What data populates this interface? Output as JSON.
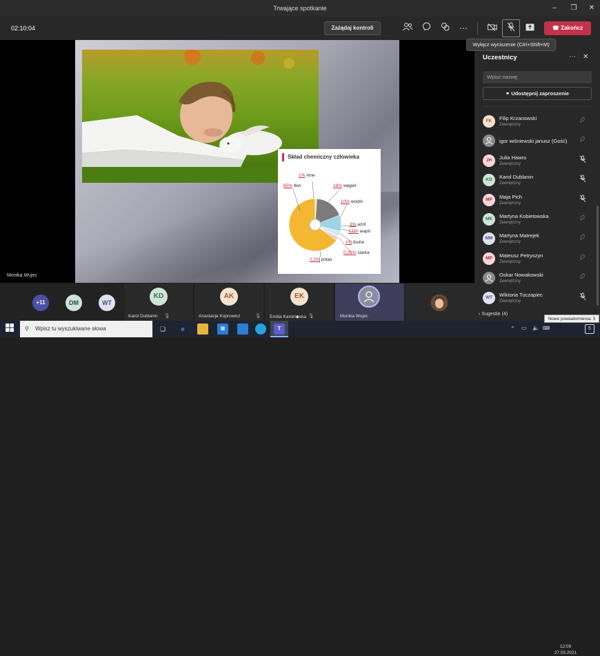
{
  "window": {
    "title": "Trwające spotkanie"
  },
  "toolbar": {
    "timer": "02:10:04",
    "request_control": "Zażądaj kontroli",
    "end_call": "Zakończ",
    "tooltip": "Wyłącz wyciszenie (Ctrl+Shift+M)"
  },
  "slide": {
    "chart_title": "Skład chemiczny człowieka",
    "chart_data": {
      "type": "pie",
      "title": "Skład chemiczny człowieka",
      "slices": [
        {
          "label": "tlen",
          "value": 65
        },
        {
          "label": "węgiel",
          "value": 18
        },
        {
          "label": "wodór",
          "value": 10
        },
        {
          "label": "azot",
          "value": 3
        },
        {
          "label": "wapń",
          "value": 1.5
        },
        {
          "label": "fosfor",
          "value": 1
        },
        {
          "label": "siarka",
          "value": 0.25
        },
        {
          "label": "potas",
          "value": 0.2
        },
        {
          "label": "inne",
          "value": 1
        }
      ]
    },
    "labels": {
      "inne_v": "1%",
      "inne": "inne",
      "tlen_v": "65%",
      "tlen": "tlen",
      "wegiel_v": "18%",
      "wegiel": "węgiel",
      "wodor_v": "10%",
      "wodor": "wodór",
      "azot_v": "3%",
      "azot": "azot",
      "wapn_v": "1,5%",
      "wapn": "wapń",
      "fosfor_v": "1%",
      "fosfor": "fosfor",
      "siarka_v": "0,25%",
      "siarka": "siarka",
      "potas_v": "0,2%",
      "potas": "potas"
    }
  },
  "speaker_name": "Monika Wujec",
  "gallery": {
    "overflow": "+11",
    "small": [
      "DM",
      "WT"
    ],
    "tiles": [
      {
        "initials": "KD",
        "name": "Karol Dublanin"
      },
      {
        "initials": "AK",
        "name": "Anastazja Koprowicz"
      },
      {
        "initials": "EK",
        "name": "Emilia Kamiń◆ska"
      },
      {
        "initials": "",
        "name": "Monika Wujec"
      }
    ]
  },
  "panel": {
    "title": "Uczestnicy",
    "search_placeholder": "Wpisz nazwę",
    "share": "Udostępnij zaproszenie",
    "participants": [
      {
        "initials": "FK",
        "name": "Filip Krzanowski",
        "sub": "Zewnętrzny"
      },
      {
        "initials": "",
        "name": "igor wiśniewski janusz (Gość)",
        "sub": ""
      },
      {
        "initials": "JH",
        "name": "Julia Hawro",
        "sub": "Zewnętrzny"
      },
      {
        "initials": "KD",
        "name": "Karol Dublanin",
        "sub": "Zewnętrzny"
      },
      {
        "initials": "MP",
        "name": "Maja Pich",
        "sub": "Zewnętrzny"
      },
      {
        "initials": "MK",
        "name": "Martyna Kobietowska",
        "sub": "Zewnętrzny"
      },
      {
        "initials": "MM",
        "name": "Martyna Matrejek",
        "sub": "Zewnętrzny"
      },
      {
        "initials": "MP",
        "name": "Mateusz Petryszyn",
        "sub": "Zewnętrzny"
      },
      {
        "initials": "",
        "name": "Oskar Nowakowski",
        "sub": "Zewnętrzny"
      },
      {
        "initials": "WT",
        "name": "Wiktoria Tuczapiec",
        "sub": "Zewnętrzny"
      }
    ],
    "suggestions": "Sugestie (4)"
  },
  "taskbar": {
    "search_placeholder": "Wpisz tu wyszukiwane słowa",
    "time": "12:09",
    "date": "27.03.2021",
    "notification": "Nowe powiadomienia: 5",
    "badge": "5"
  }
}
